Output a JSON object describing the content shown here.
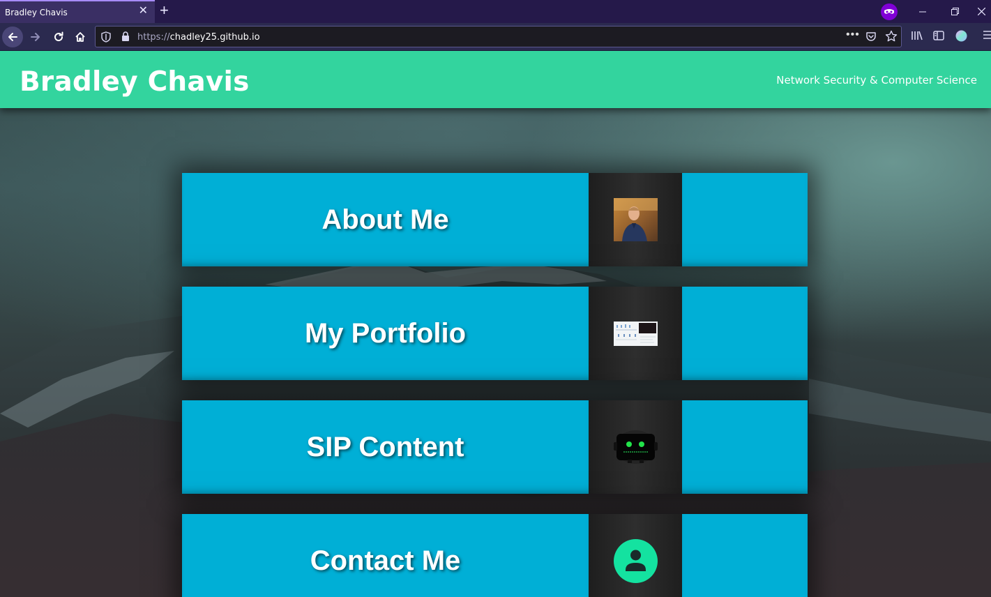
{
  "browser": {
    "tab_title": "Bradley Chavis",
    "tab_close_icon": "close-icon",
    "new_tab_icon": "plus-icon",
    "url_prefix": "https://",
    "url_host": "chadley25.github.io",
    "url_menu": "•••",
    "accent_color": "#8000d7"
  },
  "site": {
    "title": "Bradley Chavis",
    "tagline": "Network Security & Computer Science",
    "header_color": "#33d49e",
    "card_color": "#00afd6"
  },
  "cards": [
    {
      "label": "About Me",
      "thumb_icon": "profile-photo"
    },
    {
      "label": "My Portfolio",
      "thumb_icon": "portfolio-screenshot"
    },
    {
      "label": "SIP Content",
      "thumb_icon": "robot-icon"
    },
    {
      "label": "Contact Me",
      "thumb_icon": "contact-person-icon"
    }
  ]
}
